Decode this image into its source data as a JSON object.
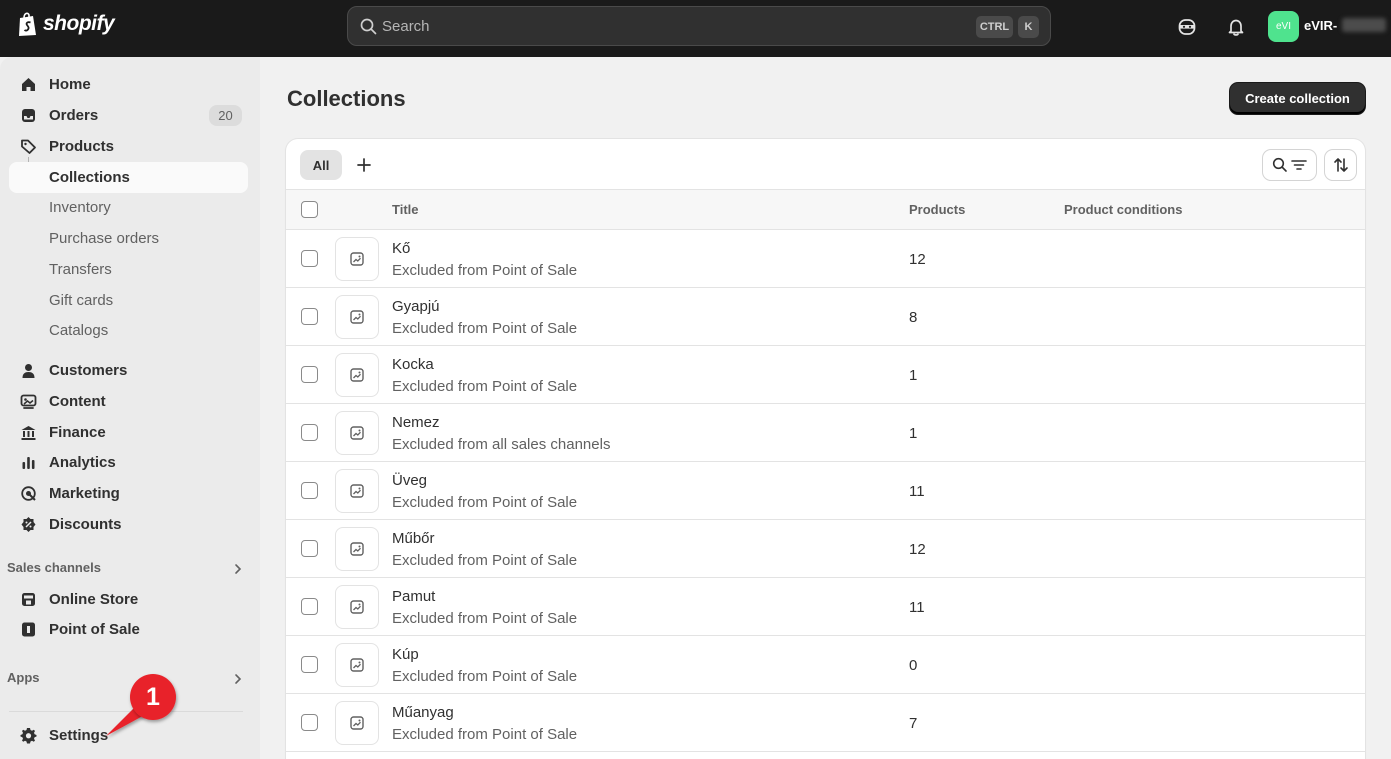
{
  "topbar": {
    "brand": "shopify",
    "search_placeholder": "Search",
    "shortcut_ctrl": "CTRL",
    "shortcut_k": "K",
    "avatar_initials": "eVI",
    "store_name": "eVIR-"
  },
  "sidebar": {
    "items": [
      {
        "label": "Home"
      },
      {
        "label": "Orders",
        "badge": "20"
      },
      {
        "label": "Products"
      },
      {
        "label": "Collections"
      },
      {
        "label": "Inventory"
      },
      {
        "label": "Purchase orders"
      },
      {
        "label": "Transfers"
      },
      {
        "label": "Gift cards"
      },
      {
        "label": "Catalogs"
      },
      {
        "label": "Customers"
      },
      {
        "label": "Content"
      },
      {
        "label": "Finance"
      },
      {
        "label": "Analytics"
      },
      {
        "label": "Marketing"
      },
      {
        "label": "Discounts"
      }
    ],
    "sales_channels_heading": "Sales channels",
    "sales_channels": [
      {
        "label": "Online Store"
      },
      {
        "label": "Point of Sale"
      }
    ],
    "apps_heading": "Apps",
    "settings_label": "Settings"
  },
  "annotation": {
    "number": "1",
    "color": "#e8212a"
  },
  "main": {
    "title": "Collections",
    "create_button": "Create collection",
    "tabs": {
      "all": "All"
    },
    "columns": {
      "title": "Title",
      "products": "Products",
      "conditions": "Product conditions"
    },
    "rows": [
      {
        "title": "Kő",
        "availability": "Excluded from Point of Sale",
        "products": "12"
      },
      {
        "title": "Gyapjú",
        "availability": "Excluded from Point of Sale",
        "products": "8"
      },
      {
        "title": "Kocka",
        "availability": "Excluded from Point of Sale",
        "products": "1"
      },
      {
        "title": "Nemez",
        "availability": "Excluded from all sales channels",
        "products": "1"
      },
      {
        "title": "Üveg",
        "availability": "Excluded from Point of Sale",
        "products": "11"
      },
      {
        "title": "Műbőr",
        "availability": "Excluded from Point of Sale",
        "products": "12"
      },
      {
        "title": "Pamut",
        "availability": "Excluded from Point of Sale",
        "products": "11"
      },
      {
        "title": "Kúp",
        "availability": "Excluded from Point of Sale",
        "products": "0"
      },
      {
        "title": "Műanyag",
        "availability": "Excluded from Point of Sale",
        "products": "7"
      }
    ]
  },
  "colors": {
    "topbar": "#1a1a1a",
    "accent_green": "#4fe38e",
    "primary_button": "#303030"
  }
}
